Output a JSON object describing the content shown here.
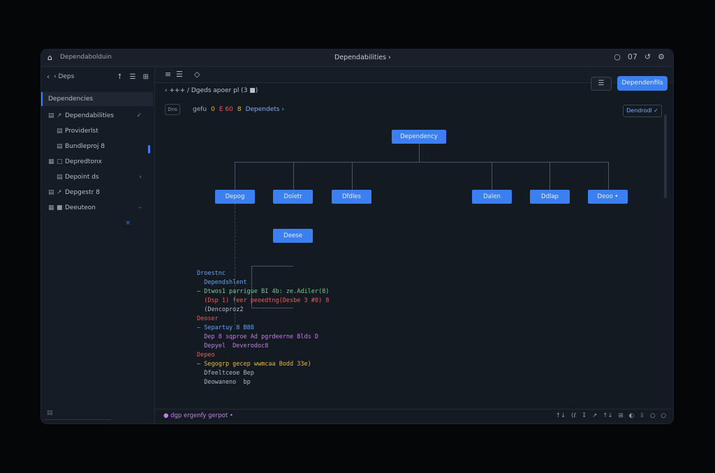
{
  "titlebar": {
    "app_icon": "home-icon",
    "app_name": "Dependabolduin",
    "title": "Dependabilities ›",
    "controls": [
      "○",
      "07",
      "↺",
      "⚙"
    ]
  },
  "sidebar": {
    "back": "‹",
    "label": "‹ Deps",
    "tools": [
      "↑",
      "☰",
      "⊞"
    ],
    "items": [
      {
        "label": "Dependencies",
        "icon": "",
        "icon2": "",
        "mark": ""
      },
      {
        "label": "Dependabilities",
        "icon": "▤",
        "icon2": "↗",
        "mark": "✓"
      },
      {
        "label": "Providerlst",
        "icon": "",
        "icon2": "▤",
        "mark": ""
      },
      {
        "label": "Bundleproj 8",
        "icon": "",
        "icon2": "▤",
        "mark": ""
      },
      {
        "label": "Depredtonx",
        "icon": "▦",
        "icon2": "□",
        "mark": ""
      },
      {
        "label": "Depoint ds",
        "icon": "",
        "icon2": "▤",
        "mark": "‹"
      },
      {
        "label": "Depgestr 8",
        "icon": "▤",
        "icon2": "↗",
        "mark": ""
      },
      {
        "label": "Deeuteon",
        "icon": "▦",
        "icon2": "■",
        "mark": "–"
      },
      {
        "label": "",
        "icon": "",
        "icon2": "",
        "mark": "×"
      }
    ],
    "footer": "▤"
  },
  "toolbar": {
    "icons": [
      "≡",
      "☰",
      "◇"
    ],
    "outline_label": "☰",
    "primary_label": "Dependenfils"
  },
  "path": "‹ +++ / Dgeds apoer pl (3 ■)",
  "legend": {
    "box_label": "Dns",
    "items": [
      {
        "text": "gefu",
        "cls": "lg-gray"
      },
      {
        "text": "0",
        "cls": "lg-yellow"
      },
      {
        "text": "E 60",
        "cls": "lg-red"
      },
      {
        "text": "8",
        "cls": "lg-yellow"
      },
      {
        "text": "Dependets ›",
        "cls": "lg-blue"
      }
    ]
  },
  "select": "Dendrodl ✓",
  "diagram": {
    "root": "Dependency",
    "children": [
      "Depog",
      "Doletr",
      "Dfdles",
      "Dalen",
      "Ddlap",
      "Deoo •"
    ],
    "grandchild": "Deese"
  },
  "code": [
    {
      "text": "Droestnc",
      "cls": "c-blue"
    },
    {
      "text": "  Dependshlent",
      "cls": "c-blue"
    },
    {
      "text": "– Dtwos1 parrigue BI 4b: ze.Adiler(8)",
      "cls": "c-green"
    },
    {
      "text": "  (Dsp 1) feer peoedtng(Desbe 3 #8) 8",
      "cls": "c-red"
    },
    {
      "text": "  (Dencoproz2",
      "cls": "c-gray"
    },
    {
      "text": "",
      "cls": "c-gray"
    },
    {
      "text": "Deoser",
      "cls": "c-red"
    },
    {
      "text": "– Separtuy 8 B88",
      "cls": "c-blue"
    },
    {
      "text": "  Dep 8 sqproe Ad pgrdeerne Blds D",
      "cls": "c-purple"
    },
    {
      "text": "  Depyel  Deverodoc8",
      "cls": "c-purple"
    },
    {
      "text": "",
      "cls": "c-gray"
    },
    {
      "text": "Depeo",
      "cls": "c-red"
    },
    {
      "text": "– Segogrp gecep wwmcaa Bodd 33e)",
      "cls": "c-yellow"
    },
    {
      "text": "  Dfeeltceoe Bep",
      "cls": "c-gray"
    },
    {
      "text": "  Deowaneno  bp",
      "cls": "c-gray"
    }
  ],
  "status": {
    "left": "● dgp ergenfy gerpot •",
    "right": [
      "↑↓",
      "(ℓ",
      "↧",
      "↗",
      "↑↓",
      "⊞",
      "◐",
      "⇩",
      "○",
      "○"
    ]
  }
}
